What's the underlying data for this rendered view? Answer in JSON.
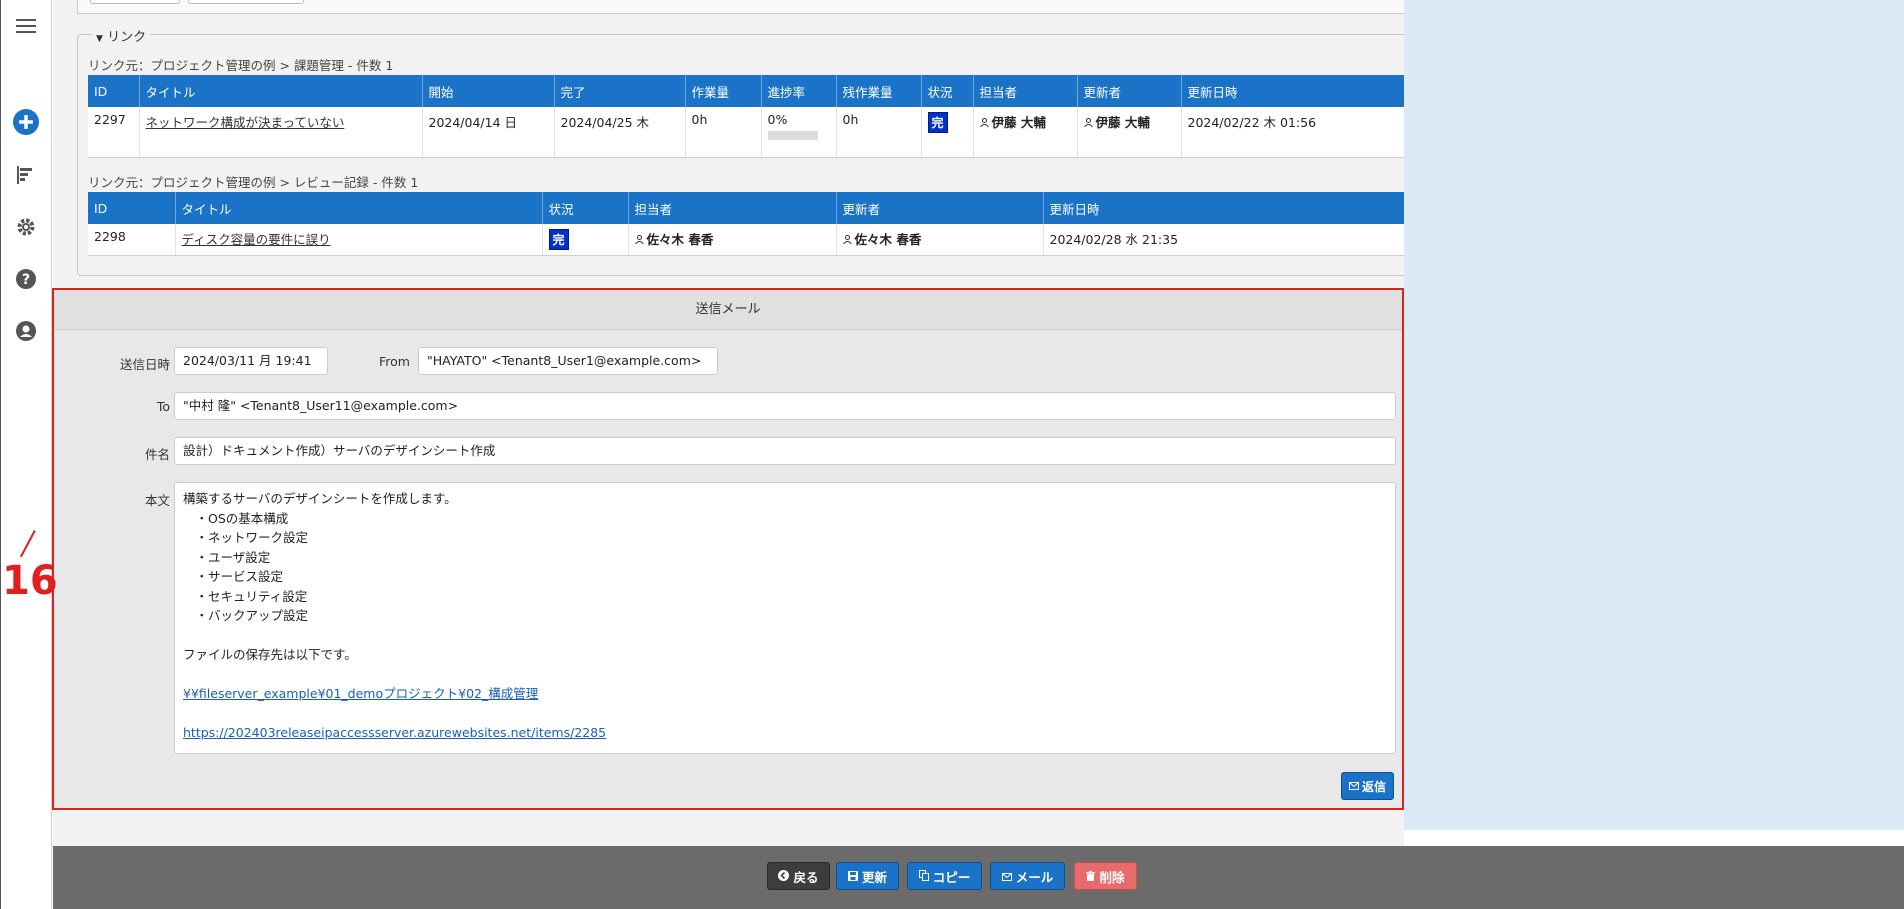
{
  "link_section": {
    "legend": "リンク",
    "tables": [
      {
        "caption": "リンク元：プロジェクト管理の例 > 課題管理 - 件数 1",
        "headers": [
          "ID",
          "タイトル",
          "開始",
          "完了",
          "作業量",
          "進捗率",
          "残作業量",
          "状況",
          "担当者",
          "更新者",
          "更新日時"
        ],
        "row": {
          "id": "2297",
          "title": "ネットワーク構成が決まっていない",
          "start": "2024/04/14 日",
          "end": "2024/04/25 木",
          "workload": "0h",
          "progress": "0%",
          "progress_value": 0,
          "remaining": "0h",
          "status": "完",
          "owner": "伊藤 大輔",
          "updater": "伊藤 大輔",
          "updated": "2024/02/22 木 01:56"
        }
      },
      {
        "caption": "リンク元：プロジェクト管理の例 > レビュー記録 - 件数 1",
        "headers": [
          "ID",
          "タイトル",
          "状況",
          "担当者",
          "更新者",
          "更新日時"
        ],
        "row": {
          "id": "2298",
          "title": "ディスク容量の要件に誤り",
          "status": "完",
          "owner": "佐々木 春香",
          "updater": "佐々木 春香",
          "updated": "2024/02/28 水 21:35"
        }
      }
    ]
  },
  "mail": {
    "header": "送信メール",
    "sent_label": "送信日時",
    "sent_value": "2024/03/11 月 19:41",
    "from_label": "From",
    "from_value": "\"HAYATO\" <Tenant8_User1@example.com>",
    "to_label": "To",
    "to_value": "\"中村 隆\" <Tenant8_User11@example.com>",
    "subject_label": "件名",
    "subject_value": "設計）ドキュメント作成）サーバのデザインシート作成",
    "body_label": "本文",
    "body_lines": [
      "構築するサーバのデザインシートを作成します。",
      "　・OSの基本構成",
      "　・ネットワーク設定",
      "　・ユーザ設定",
      "　・サービス設定",
      "　・セキュリティ設定",
      "　・バックアップ設定",
      "",
      "ファイルの保存先は以下です。",
      ""
    ],
    "body_link1": "¥¥fileserver_example¥01_demoプロジェクト¥02_構成管理",
    "body_link2": "https://202403releaseipaccessserver.azurewebsites.net/items/2285",
    "reply_label": "返信"
  },
  "annotation": {
    "number": "16"
  },
  "footer": {
    "back_label": "戻る",
    "update_label": "更新",
    "copy_label": "コピー",
    "mail_label": "メール",
    "delete_label": "削除"
  },
  "colors": {
    "header_blue": "#1a73c6",
    "annotation_red": "#e0201e",
    "status_badge": "#0033cc",
    "delete_red": "#e86b6b",
    "footer_gray": "#6b6b6b"
  },
  "icons": {
    "sidebar": [
      "hamburger-icon",
      "add-circle-icon",
      "gantt-icon",
      "gear-icon",
      "help-icon",
      "account-icon"
    ]
  }
}
